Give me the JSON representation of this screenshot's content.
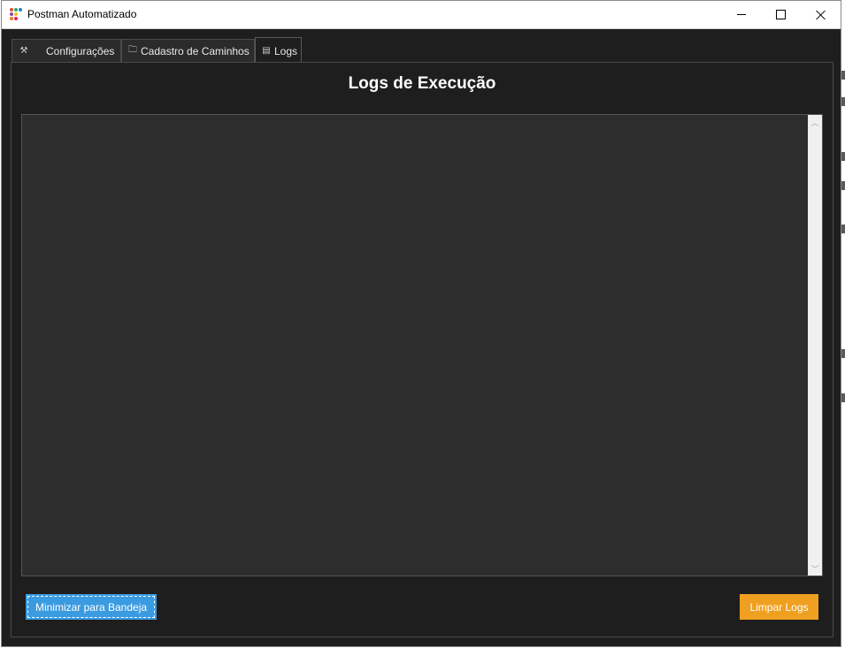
{
  "window": {
    "title": "Postman Automatizado",
    "controls": {
      "minimize": "minimize-icon",
      "maximize": "maximize-icon",
      "close": "close-icon"
    }
  },
  "tabs": [
    {
      "label": "Configurações",
      "icon": "tools-icon",
      "active": false
    },
    {
      "label": "Cadastro de Caminhos",
      "icon": "folder-icon",
      "active": false
    },
    {
      "label": "Logs",
      "icon": "document-icon",
      "active": true
    }
  ],
  "logs_panel": {
    "title": "Logs de Execução",
    "log_text": ""
  },
  "buttons": {
    "minimize_tray": "Minimizar para Bandeja",
    "clear_logs": "Limpar Logs"
  },
  "colors": {
    "background": "#1e1e1e",
    "log_area": "#2d2d2d",
    "tray_button": "#3a9be0",
    "clear_button": "#f0a020"
  }
}
